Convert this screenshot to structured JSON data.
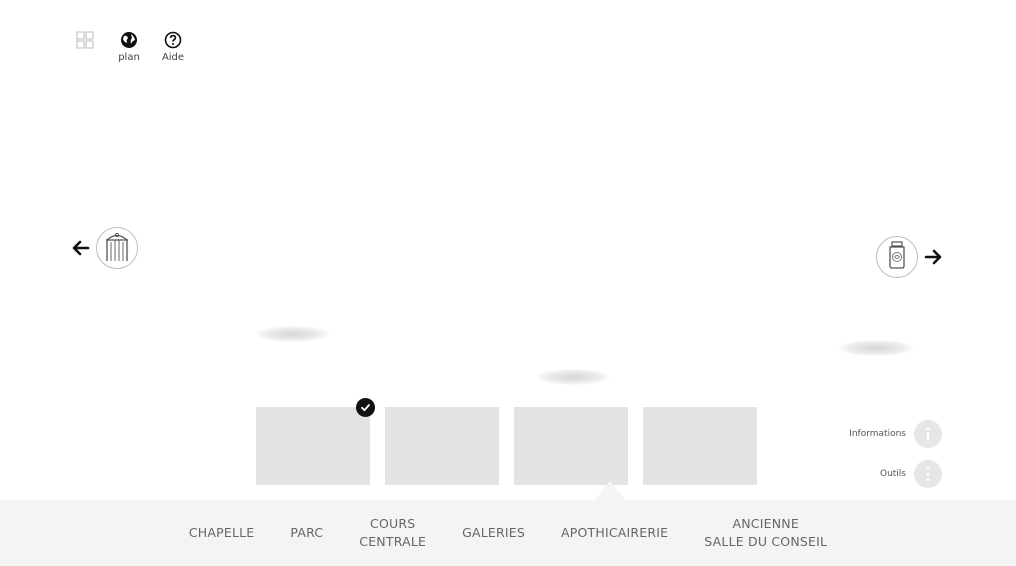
{
  "toolbar": {
    "items": [
      {
        "icon": "grid-icon",
        "label": ""
      },
      {
        "icon": "globe-icon",
        "label": "plan"
      },
      {
        "icon": "help-icon",
        "label": "Aide"
      }
    ]
  },
  "navigation": {
    "prev_icon": "arrow-left-icon",
    "prev_thumb_icon": "gate-icon",
    "next_icon": "arrow-right-icon",
    "next_thumb_icon": "apothecary-jar-icon"
  },
  "thumbnails": {
    "count": 4,
    "selected_index": 0
  },
  "side_actions": {
    "informations_label": "Informations",
    "outils_label": "Outils"
  },
  "rooms": [
    {
      "label": "CHAPELLE"
    },
    {
      "label": "PARC"
    },
    {
      "label": "COURS\nCENTRALE"
    },
    {
      "label": "GALERIES"
    },
    {
      "label": "APOTHICAIRERIE",
      "active": true
    },
    {
      "label": "ANCIENNE\nSALLE DU CONSEIL"
    }
  ]
}
